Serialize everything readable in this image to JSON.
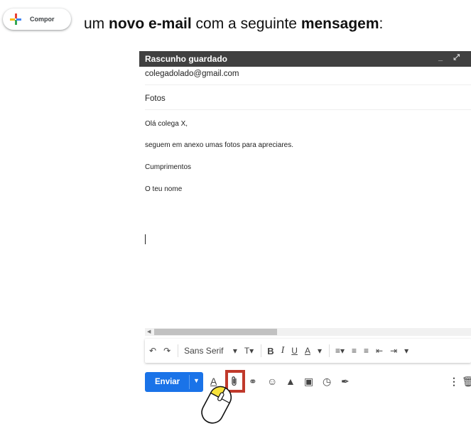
{
  "compose_button": {
    "label": "Compor",
    "icon": "multicolor-plus-icon"
  },
  "instruction": {
    "part1": "um ",
    "bold1": "novo e-mail",
    "part2": " com a seguinte ",
    "bold2": "mensagem",
    "part3": ":"
  },
  "window": {
    "title": "Rascunho guardado",
    "to": "colegadolado@gmail.com",
    "subject": "Fotos",
    "body": [
      "Olá colega X,",
      "seguem em anexo umas fotos para apreciares.",
      "Cumprimentos",
      "O teu nome"
    ]
  },
  "toolbar": {
    "font": "Sans Serif",
    "bold": "B",
    "italic": "I",
    "underline": "U",
    "textcolor": "A"
  },
  "actions": {
    "send": "Enviar",
    "highlight_color": "#c0392b",
    "send_color": "#1a73e8"
  }
}
